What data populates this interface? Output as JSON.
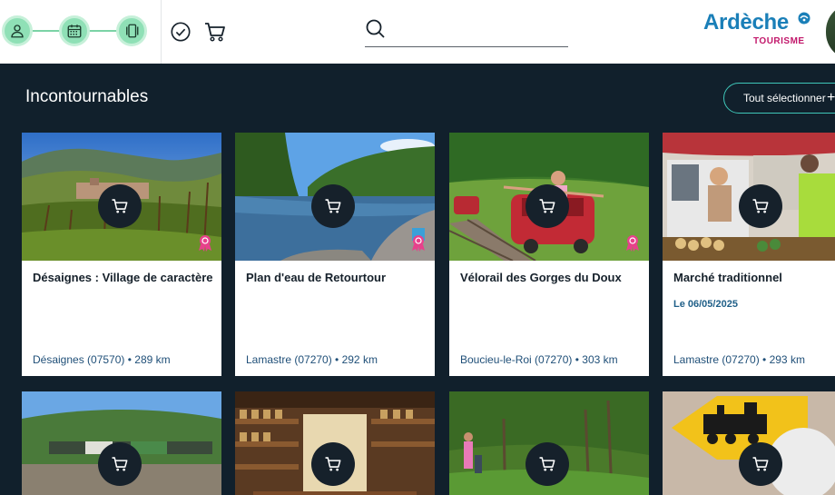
{
  "header": {
    "steps": [
      {
        "icon": "user-icon"
      },
      {
        "icon": "calendar-icon"
      },
      {
        "icon": "cards-icon"
      }
    ],
    "validate_icon": "check-circle-icon",
    "cart_icon": "cart-icon",
    "search": {
      "placeholder": "",
      "value": ""
    },
    "logo": {
      "brand": "Ardèche",
      "sub": "TOURISME"
    }
  },
  "section": {
    "title": "Incontournables",
    "select_all_label": "Tout sélectionner",
    "select_all_plus": "+"
  },
  "cards": [
    {
      "title": "Désaignes : Village de caractère",
      "date": "",
      "location": "Désaignes (07570) • 289 km",
      "award": true
    },
    {
      "title": "Plan d'eau de Retourtour",
      "date": "",
      "location": "Lamastre (07270) • 292 km",
      "award": true
    },
    {
      "title": "Vélorail des Gorges du Doux",
      "date": "",
      "location": "Boucieu-le-Roi (07270) • 303 km",
      "award": true
    },
    {
      "title": "Marché traditionnel",
      "date": "Le 06/05/2025",
      "location": "Lamastre (07270) • 293 km",
      "award": false
    }
  ],
  "colors": {
    "background": "#11202c",
    "accent_teal": "#3fc6b9",
    "step_green": "#8fe0b6",
    "brand_blue": "#1a7fb8",
    "brand_pink": "#c2186b",
    "award_pink": "#e8408c"
  }
}
